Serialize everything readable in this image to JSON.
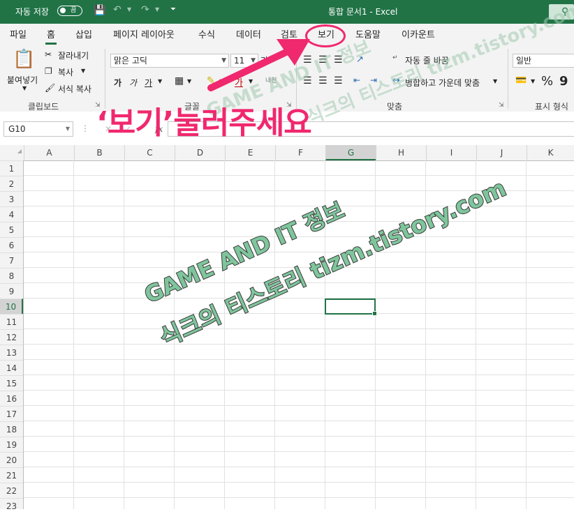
{
  "titlebar": {
    "autosave_label": "자동 저장",
    "autosave_state": "끔",
    "doc_title": "통합 문서1  -  Excel"
  },
  "tabs": [
    "파일",
    "홈",
    "삽입",
    "페이지 레이아웃",
    "수식",
    "데이터",
    "검토",
    "보기",
    "도움말",
    "이카운트"
  ],
  "ribbon": {
    "paste": "붙여넣기",
    "cut": "잘라내기",
    "copy": "복사",
    "format_painter": "서식 복사",
    "clipboard_group": "클립보드",
    "font_name": "맑은 고딕",
    "font_size": "11",
    "font_group": "글꼴",
    "bold": "가",
    "italic": "가",
    "underline": "가",
    "wrap_text": "자동 줄 바꿈",
    "merge_center": "병합하고 가운데 맞춤",
    "alignment_group": "맞춤",
    "number_format": "일반",
    "percent": "%",
    "comma": "9",
    "number_group": "표시 형식"
  },
  "formula_bar": {
    "name_box": "G10",
    "fx": "fx"
  },
  "columns": [
    "A",
    "B",
    "C",
    "D",
    "E",
    "F",
    "G",
    "H",
    "I",
    "J",
    "K"
  ],
  "rows": [
    "1",
    "2",
    "3",
    "4",
    "5",
    "6",
    "7",
    "8",
    "9",
    "10",
    "11",
    "12",
    "13",
    "14",
    "15",
    "16",
    "17",
    "18",
    "19",
    "20",
    "21",
    "22",
    "23"
  ],
  "selected_cell": "G10",
  "annotation": {
    "instruction": "‘보기’눌러주세요",
    "watermark_line1": "GAME AND IT 정보",
    "watermark_line2": "식크의 티스토리 tizm.tistory.com"
  },
  "colors": {
    "excel_green": "#217346",
    "annotation_pink": "#f0286e",
    "watermark_green": "#7fc59c"
  }
}
